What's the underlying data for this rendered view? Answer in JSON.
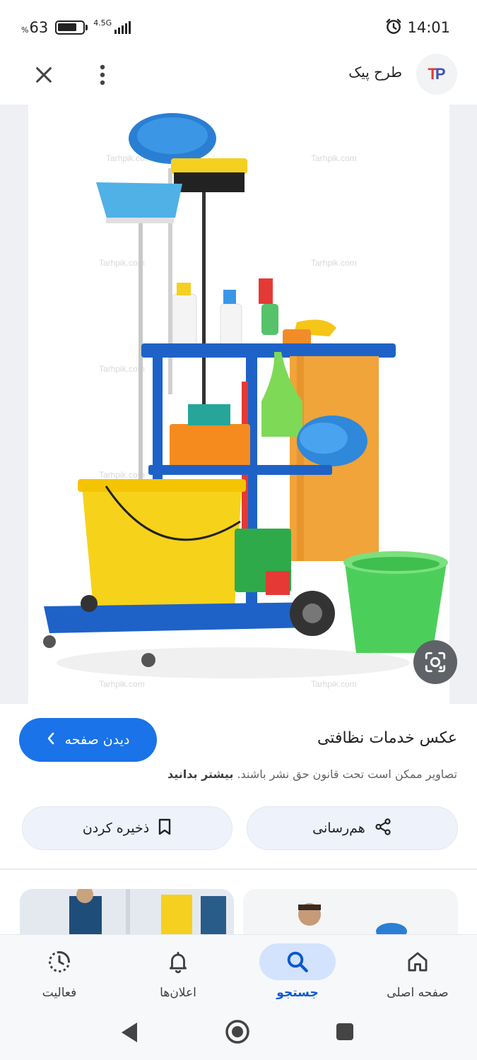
{
  "status_bar": {
    "battery_percent": "63",
    "percent_sign": "%",
    "network_label": "4.5G",
    "time": "14:01",
    "alarm_icon": "alarm-clock-icon"
  },
  "top_bar": {
    "site_name": "طرح پیک",
    "logo_text_t": "T",
    "logo_text_p": "P",
    "close_icon": "close-icon",
    "more_icon": "more-vert-icon"
  },
  "image": {
    "watermark": "Tarhpik.com",
    "lens_icon": "google-lens-icon"
  },
  "info": {
    "title": "عکس خدمات نظافتی",
    "visit_label": "دیدن صفحه",
    "copyright_text": "تصاویر ممکن است تحت قانون حق نشر باشند.",
    "learn_more": "بیشتر بدانید",
    "save_label": "ذخیره کردن",
    "share_label": "هم‌رسانی"
  },
  "bottom_nav": {
    "items": [
      {
        "label": "فعالیت",
        "icon": "activity-icon",
        "active": false
      },
      {
        "label": "اعلان‌ها",
        "icon": "bell-icon",
        "active": false
      },
      {
        "label": "جستجو",
        "icon": "search-icon",
        "active": true
      },
      {
        "label": "صفحه اصلی",
        "icon": "home-icon",
        "active": false
      }
    ]
  },
  "colors": {
    "accent": "#1a73e8",
    "nav_active_bg": "#d3e3fd",
    "nav_active_text": "#0b57d0",
    "chip_bg": "#eef2fb"
  }
}
